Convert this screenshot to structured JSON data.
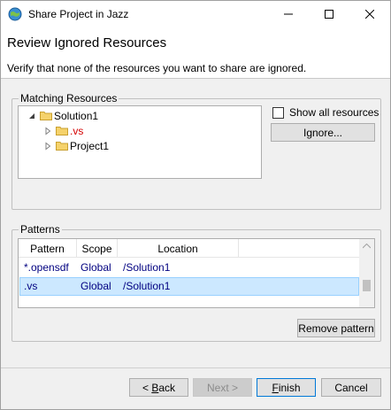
{
  "window": {
    "title": "Share Project in Jazz",
    "minimize_glyph": "—",
    "maximize_glyph": "☐",
    "close_glyph": "✕"
  },
  "header": {
    "title": "Review Ignored Resources",
    "description": "Verify that none of the resources you want to share are ignored."
  },
  "matching": {
    "label": "Matching Resources",
    "tree": [
      {
        "label": "Solution1",
        "level": 0,
        "expanded": true,
        "highlight": false
      },
      {
        "label": ".vs",
        "level": 1,
        "expanded": false,
        "highlight": true
      },
      {
        "label": "Project1",
        "level": 1,
        "expanded": false,
        "highlight": false
      }
    ],
    "show_all_label": "Show all resources",
    "show_all_checked": false,
    "ignore_button": "Ignore..."
  },
  "patterns": {
    "label": "Patterns",
    "columns": [
      "Pattern",
      "Scope",
      "Location"
    ],
    "rows": [
      {
        "pattern": "*.opensdf",
        "scope": "Global",
        "location": "/Solution1",
        "selected": false
      },
      {
        "pattern": ".vs",
        "scope": "Global",
        "location": "/Solution1",
        "selected": true
      }
    ],
    "remove_button": "Remove pattern"
  },
  "footer": {
    "back_prefix": "< ",
    "back_mnemonic": "B",
    "back_rest": "ack",
    "next_label": "Next >",
    "finish_mnemonic": "F",
    "finish_rest": "inish",
    "cancel_label": "Cancel"
  },
  "colors": {
    "accent": "#0078d7",
    "selection": "#cce8ff",
    "highlight_text": "#d40000",
    "table_text": "#000080"
  }
}
